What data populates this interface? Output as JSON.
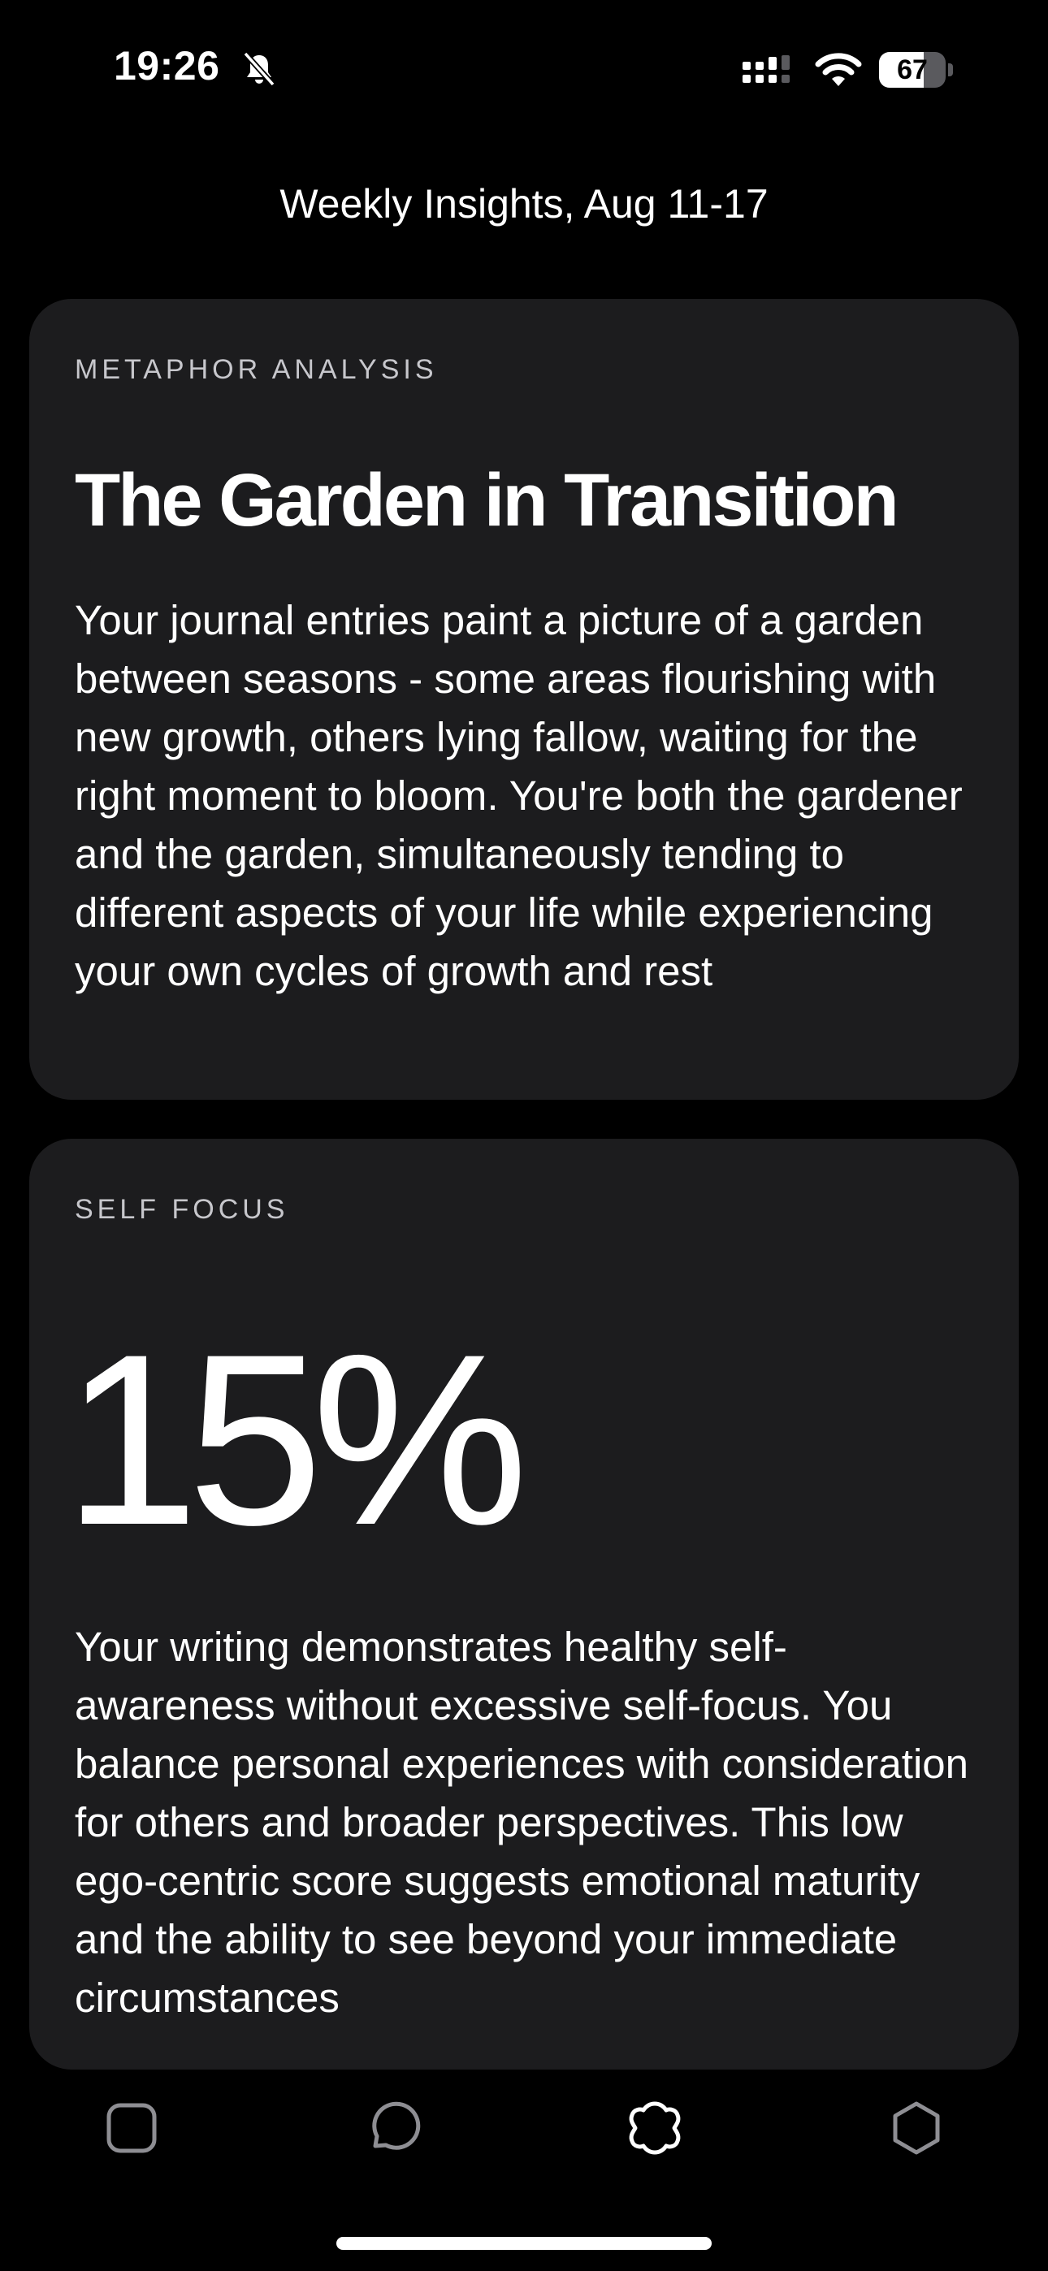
{
  "status_bar": {
    "time": "19:26",
    "battery_level": "67",
    "battery_fraction": 0.67,
    "icons": [
      "bell-off-icon",
      "signal-icon",
      "wifi-icon",
      "battery-icon"
    ]
  },
  "header": {
    "title": "Weekly Insights, Aug 11-17"
  },
  "metaphor_card": {
    "label": "METAPHOR ANALYSIS",
    "heading": "The Garden in Transition",
    "body": "Your journal entries paint a picture of a garden between seasons - some areas flourishing with new growth, others lying fallow, waiting for the right moment to bloom. You're both the gardener and the garden, simultaneously tending to different aspects of your life while experiencing your own cycles of growth and rest"
  },
  "self_focus_card": {
    "label": "SELF FOCUS",
    "value": "15%",
    "body": "Your writing demonstrates healthy self-awareness without excessive self-focus. You balance personal experiences with consideration for others and broader perspectives. This low ego-centric score suggests emotional maturity and the ability to see beyond your immediate circumstances"
  },
  "tab_bar": {
    "tabs": [
      {
        "icon": "square-icon",
        "active": false
      },
      {
        "icon": "chat-bubble-icon",
        "active": false
      },
      {
        "icon": "flower-icon",
        "active": true
      },
      {
        "icon": "hexagon-icon",
        "active": false
      }
    ]
  },
  "colors": {
    "background": "#000000",
    "card": "#1c1c1e",
    "text_primary": "#ffffff",
    "text_label": "#c7c7cc",
    "tab_inactive": "#8e8e93"
  }
}
